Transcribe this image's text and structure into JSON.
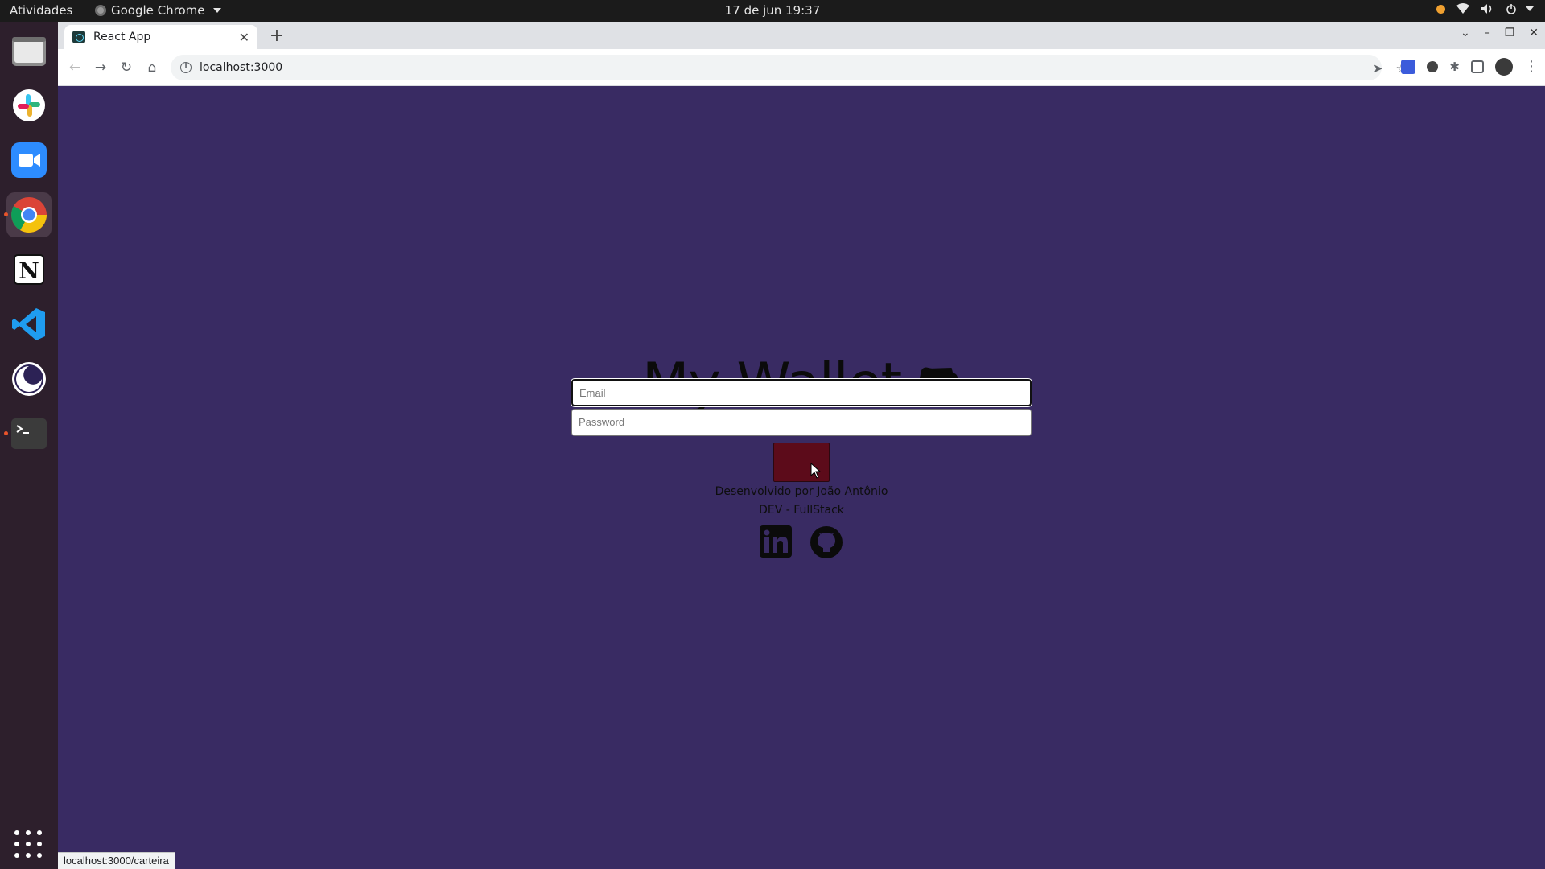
{
  "topbar": {
    "activities": "Atividades",
    "app_name": "Google Chrome",
    "clock": "17 de jun  19:37"
  },
  "dock": {
    "items": [
      "files-icon",
      "slack-icon",
      "zoom-icon",
      "chrome-icon",
      "notion-icon",
      "vscode-icon",
      "eclipse-icon",
      "terminal-icon"
    ],
    "show_apps": "apps-grid-icon"
  },
  "browser": {
    "tab_title": "React App",
    "address": "localhost:3000",
    "status_url": "localhost:3000/carteira"
  },
  "page": {
    "title": "My Wallet",
    "email_placeholder": "Email",
    "password_placeholder": "Password",
    "credit_line1": "Desenvolvido por João Antônio",
    "credit_line2": "DEV - FullStack",
    "background": "#392b63",
    "button_color": "#5c0b1a"
  }
}
